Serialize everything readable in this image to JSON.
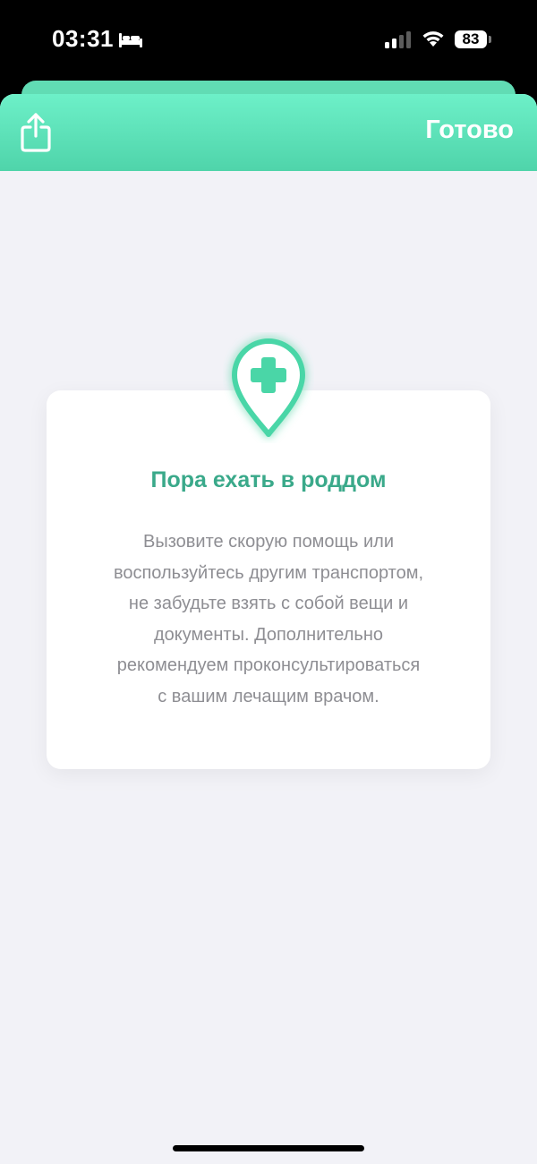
{
  "status_bar": {
    "time": "03:31",
    "battery": "83",
    "icons": [
      "bed-icon",
      "signal-icon",
      "wifi-icon",
      "battery-icon"
    ]
  },
  "header": {
    "share_icon": "share-icon",
    "done_label": "Готово",
    "accent_color": "#5ee3bb"
  },
  "card": {
    "icon": "hospital-pin-icon",
    "title": "Пора ехать в роддом",
    "title_color": "#3aa98a",
    "lines": [
      "Вызовите скорую помощь или",
      "воспользуйтесь другим транспортом,",
      "не забудьте взять с собой вещи и",
      "документы. Дополнительно",
      "рекомендуем проконсультироваться",
      "с вашим лечащим врачом."
    ]
  }
}
